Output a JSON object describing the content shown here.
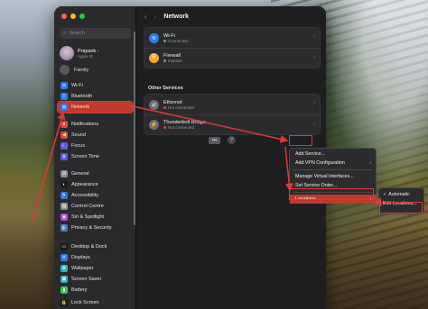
{
  "sidebar": {
    "search_placeholder": "Search",
    "profile": {
      "name": "Prayank -",
      "sub": "Apple ID"
    },
    "family": "Family",
    "items": [
      {
        "label": "Wi-Fi",
        "icon": "wifi-icon",
        "color": "#2f7cf6",
        "glyph": "≋"
      },
      {
        "label": "Bluetooth",
        "icon": "bluetooth-icon",
        "color": "#2f7cf6",
        "glyph": "ᛒ"
      },
      {
        "label": "Network",
        "icon": "globe-icon",
        "color": "#2f7cf6",
        "glyph": "◍",
        "active": true
      },
      {
        "label": "Notifications",
        "icon": "bell-icon",
        "color": "#e5443b",
        "glyph": "●"
      },
      {
        "label": "Sound",
        "icon": "speaker-icon",
        "color": "#e5443b",
        "glyph": "◀"
      },
      {
        "label": "Focus",
        "icon": "moon-icon",
        "color": "#5e5ce6",
        "glyph": "☾"
      },
      {
        "label": "Screen Time",
        "icon": "hourglass-icon",
        "color": "#5e5ce6",
        "glyph": "⧖"
      },
      {
        "label": "General",
        "icon": "gear-icon",
        "color": "#8e8e93",
        "glyph": "⚙"
      },
      {
        "label": "Appearance",
        "icon": "appearance-icon",
        "color": "#1c1c1e",
        "glyph": "◐"
      },
      {
        "label": "Accessibility",
        "icon": "accessibility-icon",
        "color": "#2f7cf6",
        "glyph": "♿"
      },
      {
        "label": "Control Centre",
        "icon": "control-centre-icon",
        "color": "#8e8e93",
        "glyph": "▤"
      },
      {
        "label": "Siri & Spotlight",
        "icon": "siri-icon",
        "color": "#b04ae0",
        "glyph": "◉"
      },
      {
        "label": "Privacy & Security",
        "icon": "hand-icon",
        "color": "#2f7cf6",
        "glyph": "✋"
      },
      {
        "label": "Desktop & Dock",
        "icon": "dock-icon",
        "color": "#1c1c1e",
        "glyph": "▭"
      },
      {
        "label": "Displays",
        "icon": "display-icon",
        "color": "#2f7cf6",
        "glyph": "☀"
      },
      {
        "label": "Wallpaper",
        "icon": "wallpaper-icon",
        "color": "#30b0c7",
        "glyph": "❋"
      },
      {
        "label": "Screen Saver",
        "icon": "screensaver-icon",
        "color": "#30b0c7",
        "glyph": "▣"
      },
      {
        "label": "Battery",
        "icon": "battery-icon",
        "color": "#34c759",
        "glyph": "▮"
      },
      {
        "label": "Lock Screen",
        "icon": "lock-icon",
        "color": "#1c1c1e",
        "glyph": "🔒"
      }
    ]
  },
  "header": {
    "title": "Network",
    "back": "‹",
    "forward": "›"
  },
  "services_top": [
    {
      "label": "Wi-Fi",
      "status": "Connected",
      "status_color": "#34c759",
      "icon": "wifi-icon",
      "color": "#2f7cf6",
      "glyph": "≋"
    },
    {
      "label": "Firewall",
      "status": "Inactive",
      "status_color": "#8e8e93",
      "icon": "shield-icon",
      "color": "#f5a623",
      "glyph": "⛨"
    }
  ],
  "other_services_title": "Other Services",
  "services_other": [
    {
      "label": "Ethernet",
      "status": "Not connected",
      "status_color": "#e5443b",
      "icon": "ethernet-icon",
      "color": "#6e6e73",
      "glyph": "⇄"
    },
    {
      "label": "Thunderbolt Bridge",
      "status": "Not connected",
      "status_color": "#e5443b",
      "icon": "thunderbolt-icon",
      "color": "#6e6e73",
      "glyph": "⚡"
    }
  ],
  "more_button": "•••",
  "help_button": "?",
  "menu": {
    "items": [
      "Add Service...",
      "Add VPN Configuration",
      "Manage Virtual Interfaces...",
      "Set Service Order..."
    ],
    "locations": "Locations",
    "submenu": {
      "automatic": "Automatic",
      "edit": "Edit Locations..."
    }
  }
}
